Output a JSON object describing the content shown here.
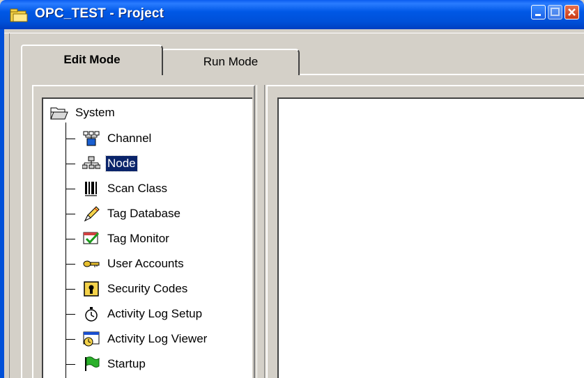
{
  "window": {
    "title": "OPC_TEST - Project"
  },
  "tabs": [
    {
      "label": "Edit Mode",
      "active": true
    },
    {
      "label": "Run Mode",
      "active": false
    }
  ],
  "tree": {
    "root": {
      "label": "System",
      "icon": "folder-open-icon"
    },
    "items": [
      {
        "label": "Channel",
        "icon": "channel-network-icon",
        "selected": false
      },
      {
        "label": "Node",
        "icon": "node-network-icon",
        "selected": true
      },
      {
        "label": "Scan Class",
        "icon": "barcode-icon",
        "selected": false
      },
      {
        "label": "Tag Database",
        "icon": "pen-document-icon",
        "selected": false
      },
      {
        "label": "Tag Monitor",
        "icon": "monitor-check-icon",
        "selected": false
      },
      {
        "label": "User Accounts",
        "icon": "key-icon",
        "selected": false
      },
      {
        "label": "Security Codes",
        "icon": "lock-icon",
        "selected": false
      },
      {
        "label": "Activity Log Setup",
        "icon": "stopwatch-icon",
        "selected": false
      },
      {
        "label": "Activity Log Viewer",
        "icon": "log-viewer-icon",
        "selected": false
      },
      {
        "label": "Startup",
        "icon": "green-flag-icon",
        "selected": false
      }
    ]
  },
  "colors": {
    "titlebar": "#0050d8",
    "selection": "#0a246a",
    "face": "#d4d0c8"
  }
}
